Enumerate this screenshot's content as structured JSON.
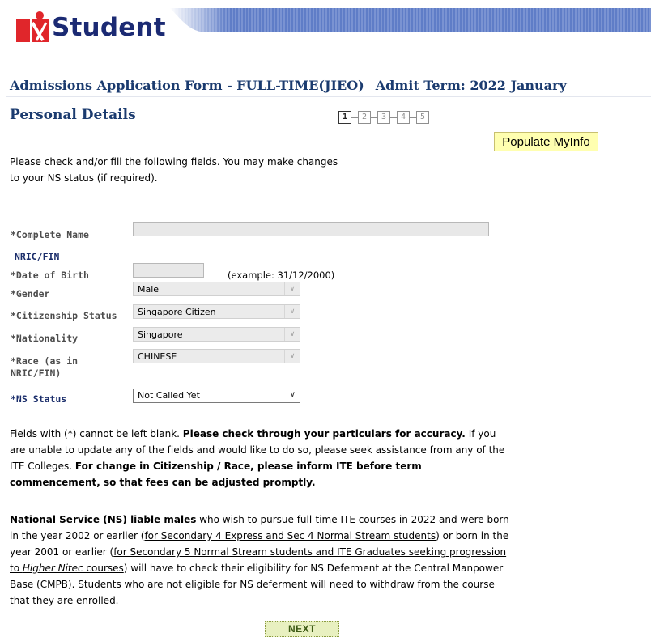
{
  "header": {
    "logo_text": "Student",
    "banner_color": "#5a78c2"
  },
  "form": {
    "title": "Admissions Application Form - FULL-TIME(JIEO)",
    "admit_term": "Admit Term: 2022 January",
    "section_title": "Personal Details",
    "steps": [
      "1",
      "2",
      "3",
      "4",
      "5"
    ],
    "active_step": "1",
    "populate_button": "Populate MyInfo",
    "intro_line1": "Please check and/or fill the following fields. You may make changes",
    "intro_line2": "to your NS status (if required).",
    "fields": {
      "complete_name_label": "*Complete Name",
      "complete_name_value": "",
      "nric_label": "NRIC/FIN",
      "dob_label": "*Date of Birth",
      "dob_value": "",
      "dob_example": "(example: 31/12/2000)",
      "gender_label": "*Gender",
      "gender_value": "Male",
      "citizenship_label": "*Citizenship Status",
      "citizenship_value": "Singapore Citizen",
      "nationality_label": "*Nationality",
      "nationality_value": "Singapore",
      "race_label_line1": "*Race (as in",
      "race_label_line2": "NRIC/FIN)",
      "race_value": "CHINESE",
      "ns_label": "*NS Status",
      "ns_value": "Not Called Yet"
    },
    "notes1": {
      "t1": "Fields with (*) cannot be left blank. ",
      "b1": "Please check through your particulars for accuracy.",
      "t2": " If you are unable to update any of the fields and would like to do so, please seek assistance from any of the ITE Colleges. ",
      "b2": "For change in Citizenship / Race, please inform ITE before term commencement, so that fees can be adjusted promptly."
    },
    "notes2": {
      "u1": "National Service (NS) liable males",
      "t1": " who wish to pursue full-time ITE courses in 2022 and were born in the year 2002 or earlier (",
      "u2": "for Secondary 4 Express and Sec 4 Normal Stream students",
      "t2": ") or born in the year 2001 or earlier (",
      "u3a": "for Secondary 5 Normal Stream students and ITE Graduates seeking progression to ",
      "u3i": "Higher Nitec",
      "u3b": " courses",
      "t3": ") will have to check their eligibility for NS Deferment at the Central Manpower Base (CMPB). Students who are not eligible for NS deferment will need to withdraw from the course that they are enrolled."
    },
    "next_button": "NEXT"
  }
}
